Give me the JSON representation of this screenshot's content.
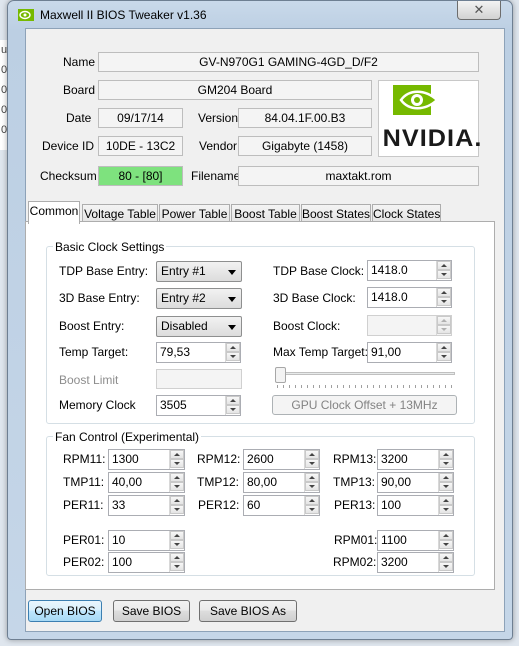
{
  "window": {
    "title": "Maxwell II BIOS Tweaker v1.36",
    "close_glyph": "✕"
  },
  "background_fragments": [
    "ur",
    "0",
    "0",
    "0",
    "0"
  ],
  "info": {
    "name_label": "Name",
    "name_value": "GV-N970G1 GAMING-4GD_D/F2",
    "board_label": "Board",
    "board_value": "GM204 Board",
    "date_label": "Date",
    "date_value": "09/17/14",
    "version_label": "Version",
    "version_value": "84.04.1F.00.B3",
    "device_label": "Device ID",
    "device_value": "10DE - 13C2",
    "vendor_label": "Vendor",
    "vendor_value": "Gigabyte (1458)",
    "checksum_label": "Checksum",
    "checksum_value": "80 - [80]",
    "filename_label": "Filename",
    "filename_value": "maxtakt.rom",
    "checksum_color": "#7ee27e"
  },
  "logo": {
    "text": "NVIDIA.",
    "brand_color": "#76b900"
  },
  "tabs": [
    "Common",
    "Voltage Table",
    "Power Table",
    "Boost Table",
    "Boost States",
    "Clock States"
  ],
  "basic": {
    "title": "Basic Clock Settings",
    "tdp_entry_label": "TDP Base Entry:",
    "tdp_entry_value": "Entry #1",
    "d3_entry_label": "3D Base Entry:",
    "d3_entry_value": "Entry #2",
    "boost_entry_label": "Boost Entry:",
    "boost_entry_value": "Disabled",
    "temp_target_label": "Temp Target:",
    "temp_target_value": "79,53",
    "boost_limit_label": "Boost Limit",
    "memory_clock_label": "Memory Clock",
    "memory_clock_value": "3505",
    "tdp_clock_label": "TDP Base Clock:",
    "tdp_clock_value": "1418.0",
    "d3_clock_label": "3D Base Clock:",
    "d3_clock_value": "1418.0",
    "boost_clock_label": "Boost Clock:",
    "max_temp_label": "Max Temp Target:",
    "max_temp_value": "91,00",
    "gpu_offset_label": "GPU Clock Offset + 13MHz"
  },
  "fan": {
    "title": "Fan Control (Experimental)",
    "rpm11_label": "RPM11:",
    "rpm11": "1300",
    "tmp11_label": "TMP11:",
    "tmp11": "40,00",
    "per11_label": "PER11:",
    "per11": "33",
    "rpm12_label": "RPM12:",
    "rpm12": "2600",
    "tmp12_label": "TMP12:",
    "tmp12": "80,00",
    "per12_label": "PER12:",
    "per12": "60",
    "rpm13_label": "RPM13:",
    "rpm13": "3200",
    "tmp13_label": "TMP13:",
    "tmp13": "90,00",
    "per13_label": "PER13:",
    "per13": "100",
    "per01_label": "PER01:",
    "per01": "10",
    "per02_label": "PER02:",
    "per02": "100",
    "rpm01_label": "RPM01:",
    "rpm01": "1100",
    "rpm02_label": "RPM02:",
    "rpm02": "3200"
  },
  "buttons": {
    "open": "Open BIOS",
    "save": "Save BIOS",
    "save_as": "Save BIOS As"
  }
}
